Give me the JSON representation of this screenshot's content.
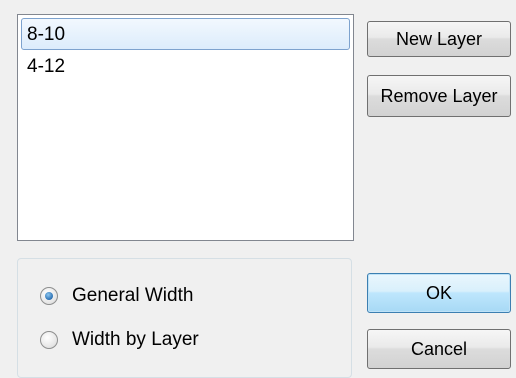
{
  "layer_list": {
    "items": [
      {
        "label": "8-10",
        "selected": true
      },
      {
        "label": "4-12",
        "selected": false
      }
    ]
  },
  "buttons": {
    "new_layer": "New Layer",
    "remove_layer": "Remove Layer",
    "ok": "OK",
    "cancel": "Cancel"
  },
  "width_options": {
    "general_width": {
      "label": "General Width",
      "checked": true
    },
    "width_by_layer": {
      "label": "Width by Layer",
      "checked": false
    }
  },
  "colors": {
    "selection_border": "#7da2ce",
    "radio_dot": "#2a6fb2",
    "default_button_border": "#3c7fb1"
  }
}
